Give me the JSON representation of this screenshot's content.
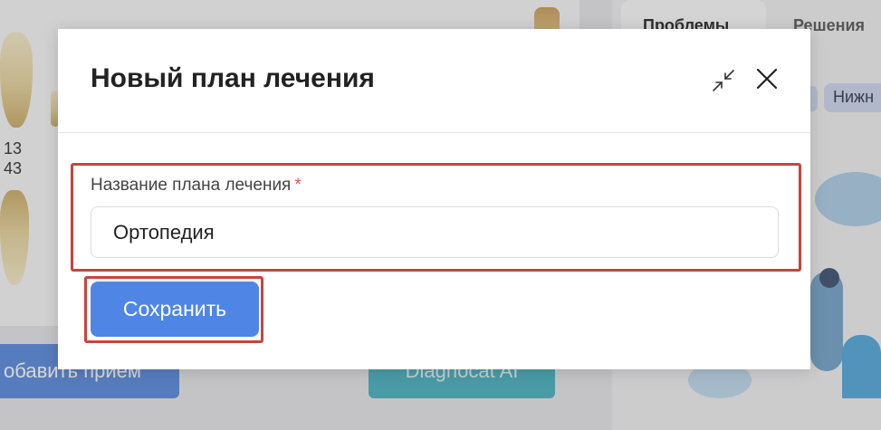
{
  "background": {
    "tooth_numbers": [
      "13",
      "43"
    ],
    "add_visit_button": "обавить прием",
    "diagnocat_button": "Diagnocat AI",
    "tab_problems": "Проблемы",
    "tab_solutions": "Решения",
    "chip_lower": "Нижн"
  },
  "modal": {
    "title": "Новый план лечения",
    "field_label": "Название плана лечения",
    "required_mark": "*",
    "field_value": "Ортопедия",
    "save_label": "Сохранить",
    "collapse_icon": "collapse-arrows-icon",
    "close_icon": "close-icon"
  },
  "colors": {
    "primary": "#4f86e6",
    "highlight": "#c8443c",
    "required": "#e0524a"
  }
}
